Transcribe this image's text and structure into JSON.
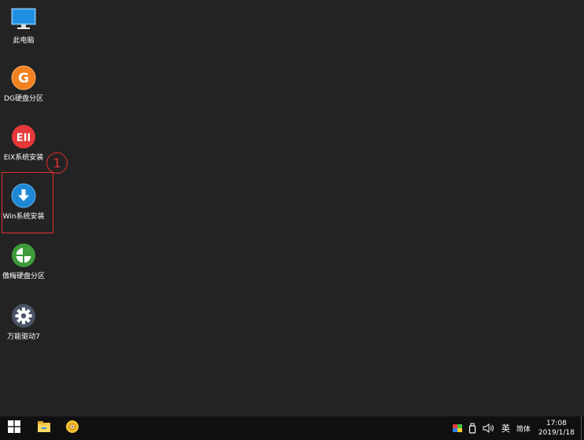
{
  "desktop": {
    "icons": [
      {
        "label": "此电脑",
        "icon": "computer-icon"
      },
      {
        "label": "DG硬盘分区",
        "icon": "diskgenius-icon",
        "glyph": "G",
        "color": "#f0811e"
      },
      {
        "label": "EIX系统安装",
        "icon": "eix-icon",
        "glyph": "EII",
        "color": "#e53838"
      },
      {
        "label": "Win系统安装",
        "icon": "win-install-icon",
        "color": "#1f88d4"
      },
      {
        "label": "傲梅硬盘分区",
        "icon": "aomei-partition-icon",
        "color": "#3d9b3a"
      },
      {
        "label": "万能驱动7",
        "icon": "driver-gear-icon",
        "color": "#4a5464"
      }
    ],
    "annotation": {
      "step": "1",
      "color": "#e33030"
    }
  },
  "taskbar": {
    "start_icon": "windows-logo-icon",
    "pinned": [
      "file-explorer-icon",
      "disc-icon"
    ],
    "tray": {
      "flag_icon": "color-flag-icon",
      "usb_icon": "usb-drive-icon",
      "volume_icon": "speaker-icon",
      "ime_lang": "英",
      "ime_mode": "简体",
      "time": "17:08",
      "date": "2019/1/18"
    }
  }
}
